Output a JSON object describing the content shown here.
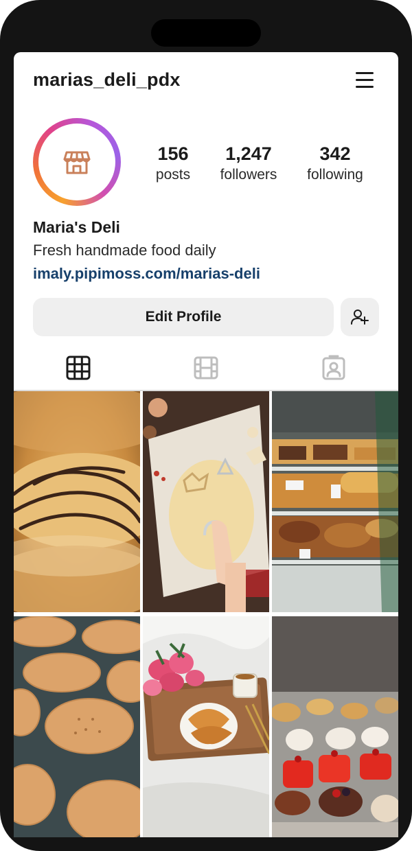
{
  "profile": {
    "username": "marias_deli_pdx",
    "display_name": "Maria's Deli",
    "bio": "Fresh handmade food daily",
    "link": "imaly.pipimoss.com/marias-deli",
    "avatar_icon": "storefront-icon"
  },
  "stats": {
    "posts": {
      "value": "156",
      "label": "posts"
    },
    "followers": {
      "value": "1,247",
      "label": "followers"
    },
    "following": {
      "value": "342",
      "label": "following"
    }
  },
  "actions": {
    "edit_profile_label": "Edit Profile",
    "add_user_icon": "add-person-icon"
  },
  "tabs": [
    {
      "name": "grid",
      "icon": "grid-icon",
      "active": true
    },
    {
      "name": "reels",
      "icon": "film-icon",
      "active": false
    },
    {
      "name": "tagged",
      "icon": "tagged-person-icon",
      "active": false
    }
  ],
  "colors": {
    "link": "#17406b",
    "button_bg": "#efefef",
    "story_ring": [
      "#f7a12e",
      "#e0428a",
      "#9b62e8"
    ],
    "avatar_icon": "#c9805a"
  },
  "posts": [
    {
      "subject": "chocolate-drizzled croissant pastry"
    },
    {
      "subject": "rolling cookie dough with cutters"
    },
    {
      "subject": "bakery display case with pastries"
    },
    {
      "subject": "round shortbread cookies on tray"
    },
    {
      "subject": "croissants with tulips on tray"
    },
    {
      "subject": "red glazed mini cakes in display"
    }
  ]
}
